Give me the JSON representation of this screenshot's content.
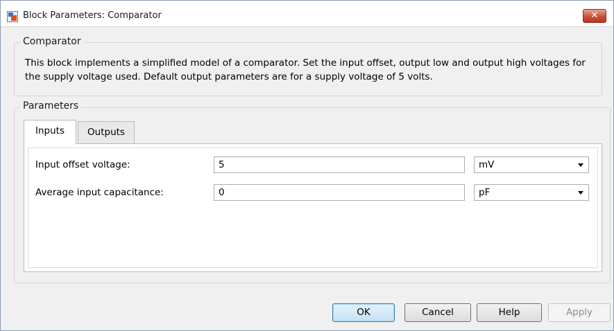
{
  "window": {
    "title": "Block Parameters: Comparator",
    "close_label": "✕"
  },
  "block_group": {
    "label": "Comparator",
    "description": "This block implements a simplified model of a comparator. Set the input offset, output low and output high voltages for the supply voltage used. Default output parameters are for a supply voltage of 5 volts."
  },
  "parameters_group": {
    "label": "Parameters",
    "tabs": [
      {
        "label": "Inputs",
        "active": true
      },
      {
        "label": "Outputs",
        "active": false
      }
    ],
    "fields": [
      {
        "label": "Input offset voltage:",
        "value": "5",
        "unit": "mV"
      },
      {
        "label": "Average input capacitance:",
        "value": "0",
        "unit": "pF"
      }
    ]
  },
  "buttons": {
    "ok": "OK",
    "cancel": "Cancel",
    "help": "Help",
    "apply": "Apply"
  },
  "colors": {
    "accent": "#3c7fb1",
    "close": "#c9513a"
  }
}
